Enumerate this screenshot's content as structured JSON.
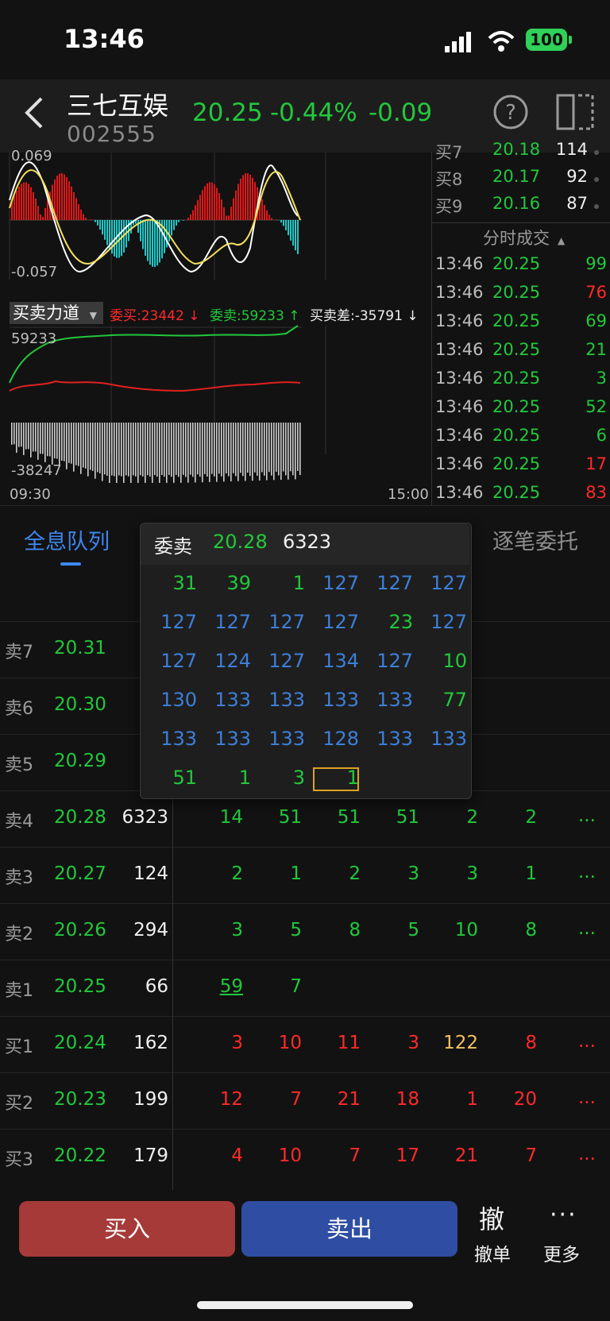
{
  "status": {
    "time": "13:46",
    "battery": "100"
  },
  "header": {
    "name": "三七互娱",
    "code": "002555",
    "price": "20.25",
    "pct": "-0.44%",
    "change": "-0.09"
  },
  "chart": {
    "macd_top": "0.069",
    "macd_bottom": "-0.057",
    "bsf": {
      "label": "买卖力道",
      "buy": "委买:23442",
      "sell": "委卖:59233",
      "diff": "买卖差:-35791"
    },
    "panel_top": "59233",
    "panel_bottom": "-38247",
    "t_start": "09:30",
    "t_end": "15:00"
  },
  "orderbook_right": [
    {
      "label": "买7",
      "price": "20.18",
      "vol": "114"
    },
    {
      "label": "买8",
      "price": "20.17",
      "vol": "92"
    },
    {
      "label": "买9",
      "price": "20.16",
      "vol": "87"
    }
  ],
  "trades_header": "分时成交",
  "trades": [
    {
      "time": "13:46",
      "price": "20.25",
      "vol": "99",
      "dir": "g"
    },
    {
      "time": "13:46",
      "price": "20.25",
      "vol": "76",
      "dir": "r"
    },
    {
      "time": "13:46",
      "price": "20.25",
      "vol": "69",
      "dir": "g"
    },
    {
      "time": "13:46",
      "price": "20.25",
      "vol": "21",
      "dir": "g"
    },
    {
      "time": "13:46",
      "price": "20.25",
      "vol": "3",
      "dir": "g"
    },
    {
      "time": "13:46",
      "price": "20.25",
      "vol": "52",
      "dir": "g"
    },
    {
      "time": "13:46",
      "price": "20.25",
      "vol": "6",
      "dir": "g"
    },
    {
      "time": "13:46",
      "price": "20.25",
      "vol": "17",
      "dir": "r"
    },
    {
      "time": "13:46",
      "price": "20.25",
      "vol": "83",
      "dir": "r"
    }
  ],
  "tabs": {
    "queue": "全息队列",
    "order": "逐笔委托"
  },
  "popup": {
    "title": "委卖",
    "price": "20.28",
    "vol": "6323",
    "rows": [
      [
        [
          "31",
          "g"
        ],
        [
          "39",
          "g"
        ],
        [
          "1",
          "g"
        ],
        [
          "127",
          "b"
        ],
        [
          "127",
          "b"
        ],
        [
          "127",
          "b"
        ]
      ],
      [
        [
          "127",
          "b"
        ],
        [
          "127",
          "b"
        ],
        [
          "127",
          "b"
        ],
        [
          "127",
          "b"
        ],
        [
          "23",
          "g"
        ],
        [
          "127",
          "b"
        ]
      ],
      [
        [
          "127",
          "b"
        ],
        [
          "124",
          "b"
        ],
        [
          "127",
          "b"
        ],
        [
          "134",
          "b"
        ],
        [
          "127",
          "b"
        ],
        [
          "10",
          "g"
        ]
      ],
      [
        [
          "130",
          "b"
        ],
        [
          "133",
          "b"
        ],
        [
          "133",
          "b"
        ],
        [
          "133",
          "b"
        ],
        [
          "133",
          "b"
        ],
        [
          "77",
          "g"
        ]
      ],
      [
        [
          "133",
          "b"
        ],
        [
          "133",
          "b"
        ],
        [
          "133",
          "b"
        ],
        [
          "128",
          "b"
        ],
        [
          "133",
          "b"
        ],
        [
          "133",
          "b"
        ]
      ],
      [
        [
          "51",
          "g"
        ],
        [
          "1",
          "g"
        ],
        [
          "3",
          "g"
        ],
        [
          "1",
          "g"
        ]
      ]
    ]
  },
  "book": [
    {
      "label": "卖7",
      "price": "20.31",
      "vol": "",
      "q": []
    },
    {
      "label": "卖6",
      "price": "20.30",
      "vol": "",
      "q": []
    },
    {
      "label": "卖5",
      "price": "20.29",
      "vol": "",
      "q": []
    },
    {
      "label": "卖4",
      "price": "20.28",
      "vol": "6323",
      "q": [
        [
          "14",
          "g"
        ],
        [
          "51",
          "g"
        ],
        [
          "51",
          "g"
        ],
        [
          "51",
          "g"
        ],
        [
          "2",
          "g"
        ],
        [
          "2",
          "g"
        ]
      ],
      "more": "..."
    },
    {
      "label": "卖3",
      "price": "20.27",
      "vol": "124",
      "q": [
        [
          "2",
          "g"
        ],
        [
          "1",
          "g"
        ],
        [
          "2",
          "g"
        ],
        [
          "3",
          "g"
        ],
        [
          "3",
          "g"
        ],
        [
          "1",
          "g"
        ]
      ],
      "more": "..."
    },
    {
      "label": "卖2",
      "price": "20.26",
      "vol": "294",
      "q": [
        [
          "3",
          "g"
        ],
        [
          "5",
          "g"
        ],
        [
          "8",
          "g"
        ],
        [
          "5",
          "g"
        ],
        [
          "10",
          "g"
        ],
        [
          "8",
          "g"
        ]
      ],
      "more": "..."
    },
    {
      "label": "卖1",
      "price": "20.25",
      "vol": "66",
      "q": [
        [
          "59",
          "g"
        ],
        [
          "7",
          "g"
        ]
      ]
    },
    {
      "label": "买1",
      "price": "20.24",
      "vol": "162",
      "q": [
        [
          "3",
          "r"
        ],
        [
          "10",
          "r"
        ],
        [
          "11",
          "r"
        ],
        [
          "3",
          "r"
        ],
        [
          "122",
          "y"
        ],
        [
          "8",
          "r"
        ]
      ],
      "more": "..."
    },
    {
      "label": "买2",
      "price": "20.23",
      "vol": "199",
      "q": [
        [
          "12",
          "r"
        ],
        [
          "7",
          "r"
        ],
        [
          "21",
          "r"
        ],
        [
          "18",
          "r"
        ],
        [
          "1",
          "r"
        ],
        [
          "20",
          "r"
        ]
      ],
      "more": "..."
    },
    {
      "label": "买3",
      "price": "20.22",
      "vol": "179",
      "q": [
        [
          "4",
          "r"
        ],
        [
          "10",
          "r"
        ],
        [
          "7",
          "r"
        ],
        [
          "17",
          "r"
        ],
        [
          "21",
          "r"
        ],
        [
          "7",
          "r"
        ]
      ],
      "more": "..."
    }
  ],
  "actions": {
    "buy": "买入",
    "sell": "卖出",
    "cancel_icon": "撤",
    "cancel": "撤单",
    "more_icon": "···",
    "more": "更多"
  }
}
